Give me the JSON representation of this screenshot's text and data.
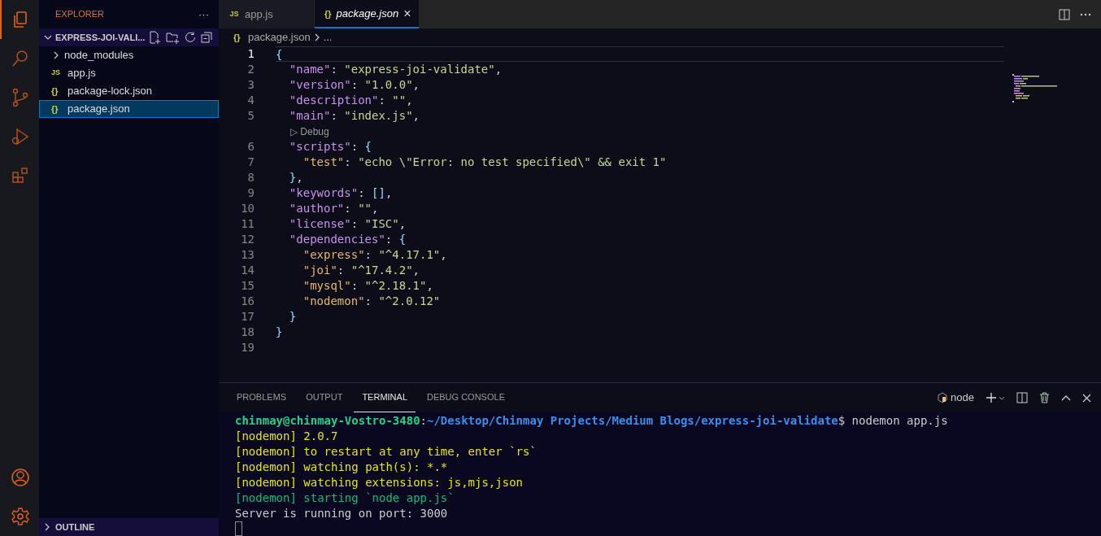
{
  "activity_bar": {
    "items": [
      {
        "kind": "files",
        "selected": true
      },
      {
        "kind": "search",
        "selected": false
      },
      {
        "kind": "source-control",
        "selected": false
      },
      {
        "kind": "run",
        "selected": false
      },
      {
        "kind": "extensions",
        "selected": false
      }
    ],
    "bottom_items": [
      {
        "kind": "account"
      },
      {
        "kind": "settings"
      }
    ]
  },
  "sidebar": {
    "title": "EXPLORER",
    "more": "···",
    "tree": [
      {
        "label": "EXPRESS-JOI-VALI...",
        "kind": "root",
        "expanded": true,
        "children": [
          {
            "label": "node_modules",
            "kind": "folder",
            "expanded": false,
            "selected": false
          },
          {
            "label": "app.js",
            "kind": "js",
            "icon": "JS",
            "selected": false
          },
          {
            "label": "package-lock.json",
            "kind": "json",
            "icon": "{}",
            "selected": false
          },
          {
            "label": "package.json",
            "kind": "json",
            "icon": "{}",
            "selected": true
          }
        ]
      }
    ],
    "outline": {
      "label": "OUTLINE",
      "expanded": false
    }
  },
  "tabs": [
    {
      "label": "app.js",
      "kind": "js",
      "icon": "JS",
      "selected": false,
      "preview": false
    },
    {
      "label": "package.json",
      "kind": "json",
      "icon": "{}",
      "selected": true,
      "preview": true,
      "close": "×"
    }
  ],
  "breadcrumb": [
    {
      "label": "package.json",
      "kind": "json",
      "icon": "{}"
    },
    {
      "label": "...",
      "kind": "more"
    }
  ],
  "editor": {
    "lines": [
      {
        "kind": "code",
        "number": "1",
        "current": true,
        "tokens": [
          {
            "kind": "bracket",
            "text": "{"
          }
        ]
      },
      {
        "kind": "code",
        "number": "2",
        "current": false,
        "tokens": [
          {
            "kind": "key",
            "text": "  \"name\""
          },
          {
            "kind": "punct",
            "text": ": "
          },
          {
            "kind": "string",
            "text": "\"express-joi-validate\""
          },
          {
            "kind": "punct",
            "text": ","
          }
        ]
      },
      {
        "kind": "code",
        "number": "3",
        "current": false,
        "tokens": [
          {
            "kind": "key",
            "text": "  \"version\""
          },
          {
            "kind": "punct",
            "text": ": "
          },
          {
            "kind": "string",
            "text": "\"1.0.0\""
          },
          {
            "kind": "punct",
            "text": ","
          }
        ]
      },
      {
        "kind": "code",
        "number": "4",
        "current": false,
        "tokens": [
          {
            "kind": "key",
            "text": "  \"description\""
          },
          {
            "kind": "punct",
            "text": ": "
          },
          {
            "kind": "string",
            "text": "\"\""
          },
          {
            "kind": "punct",
            "text": ","
          }
        ]
      },
      {
        "kind": "code",
        "number": "5",
        "current": false,
        "tokens": [
          {
            "kind": "key",
            "text": "  \"main\""
          },
          {
            "kind": "punct",
            "text": ": "
          },
          {
            "kind": "string",
            "text": "\"index.js\""
          },
          {
            "kind": "punct",
            "text": ","
          }
        ]
      },
      {
        "kind": "codelens",
        "icon": "▷",
        "text": "Debug"
      },
      {
        "kind": "code",
        "number": "6",
        "current": false,
        "tokens": [
          {
            "kind": "key",
            "text": "  \"scripts\""
          },
          {
            "kind": "punct",
            "text": ": "
          },
          {
            "kind": "bracket",
            "text": "{"
          }
        ]
      },
      {
        "kind": "code",
        "number": "7",
        "current": false,
        "tokens": [
          {
            "kind": "key2",
            "text": "    \"test\""
          },
          {
            "kind": "punct",
            "text": ": "
          },
          {
            "kind": "string",
            "text": "\"echo \\\"Error: no test specified\\\" && exit 1\""
          }
        ]
      },
      {
        "kind": "code",
        "number": "8",
        "current": false,
        "tokens": [
          {
            "kind": "bracket",
            "text": "  }"
          },
          {
            "kind": "punct",
            "text": ","
          }
        ]
      },
      {
        "kind": "code",
        "number": "9",
        "current": false,
        "tokens": [
          {
            "kind": "key",
            "text": "  \"keywords\""
          },
          {
            "kind": "punct",
            "text": ": "
          },
          {
            "kind": "bracket",
            "text": "[]"
          },
          {
            "kind": "punct",
            "text": ","
          }
        ]
      },
      {
        "kind": "code",
        "number": "10",
        "current": false,
        "tokens": [
          {
            "kind": "key",
            "text": "  \"author\""
          },
          {
            "kind": "punct",
            "text": ": "
          },
          {
            "kind": "string",
            "text": "\"\""
          },
          {
            "kind": "punct",
            "text": ","
          }
        ]
      },
      {
        "kind": "code",
        "number": "11",
        "current": false,
        "tokens": [
          {
            "kind": "key",
            "text": "  \"license\""
          },
          {
            "kind": "punct",
            "text": ": "
          },
          {
            "kind": "string",
            "text": "\"ISC\""
          },
          {
            "kind": "punct",
            "text": ","
          }
        ]
      },
      {
        "kind": "code",
        "number": "12",
        "current": false,
        "tokens": [
          {
            "kind": "key",
            "text": "  \"dependencies\""
          },
          {
            "kind": "punct",
            "text": ": "
          },
          {
            "kind": "bracket",
            "text": "{"
          }
        ]
      },
      {
        "kind": "code",
        "number": "13",
        "current": false,
        "tokens": [
          {
            "kind": "key2",
            "text": "    \"express\""
          },
          {
            "kind": "punct",
            "text": ": "
          },
          {
            "kind": "string",
            "text": "\"^4.17.1\""
          },
          {
            "kind": "punct",
            "text": ","
          }
        ]
      },
      {
        "kind": "code",
        "number": "14",
        "current": false,
        "tokens": [
          {
            "kind": "key2",
            "text": "    \"joi\""
          },
          {
            "kind": "punct",
            "text": ": "
          },
          {
            "kind": "string",
            "text": "\"^17.4.2\""
          },
          {
            "kind": "punct",
            "text": ","
          }
        ]
      },
      {
        "kind": "code",
        "number": "15",
        "current": false,
        "tokens": [
          {
            "kind": "key2",
            "text": "    \"mysql\""
          },
          {
            "kind": "punct",
            "text": ": "
          },
          {
            "kind": "string",
            "text": "\"^2.18.1\""
          },
          {
            "kind": "punct",
            "text": ","
          }
        ]
      },
      {
        "kind": "code",
        "number": "16",
        "current": false,
        "tokens": [
          {
            "kind": "key2",
            "text": "    \"nodemon\""
          },
          {
            "kind": "punct",
            "text": ": "
          },
          {
            "kind": "string",
            "text": "\"^2.0.12\""
          }
        ]
      },
      {
        "kind": "code",
        "number": "17",
        "current": false,
        "tokens": [
          {
            "kind": "bracket",
            "text": "  }"
          }
        ]
      },
      {
        "kind": "code",
        "number": "18",
        "current": false,
        "tokens": [
          {
            "kind": "bracket",
            "text": "}"
          }
        ]
      },
      {
        "kind": "code",
        "number": "19",
        "current": false
      }
    ]
  },
  "panel": {
    "tabs": [
      {
        "label": "PROBLEMS",
        "selected": false
      },
      {
        "label": "OUTPUT",
        "selected": false
      },
      {
        "label": "TERMINAL",
        "selected": true
      },
      {
        "label": "DEBUG CONSOLE",
        "selected": false
      }
    ],
    "terminal_name": "node",
    "terminal": [
      [
        {
          "kind": "user",
          "text": "chinmay@chinmay-Vostro-3480"
        },
        {
          "kind": "plain",
          "text": ":"
        },
        {
          "kind": "path",
          "text": "~/Desktop/Chinmay Projects/Medium Blogs/express-joi-validate"
        },
        {
          "kind": "plain",
          "text": "$ nodemon app.js"
        }
      ],
      [
        {
          "kind": "yellow",
          "text": "[nodemon] 2.0.7"
        }
      ],
      [
        {
          "kind": "yellow",
          "text": "[nodemon] to restart at any time, enter `rs`"
        }
      ],
      [
        {
          "kind": "yellow",
          "text": "[nodemon] watching path(s): *.*"
        }
      ],
      [
        {
          "kind": "yellow",
          "text": "[nodemon] watching extensions: js,mjs,json"
        }
      ],
      [
        {
          "kind": "green",
          "text": "[nodemon] starting `node app.js`"
        }
      ],
      [
        {
          "kind": "plain",
          "text": "Server is running on port: 3000"
        }
      ]
    ],
    "cursor": true
  }
}
